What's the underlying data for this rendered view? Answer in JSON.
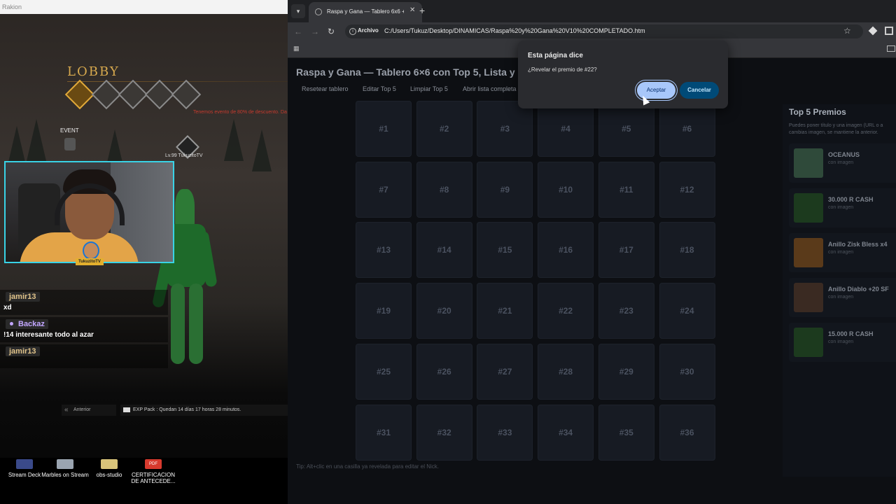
{
  "window": {
    "title": "Rakion"
  },
  "game": {
    "lobby_title": "LOBBY",
    "discount_text": "Tenemos evento de 80% de descuento. Da",
    "event_label": "EVENT",
    "player_label": "Lv.99 TukuzitoTV",
    "stream_logo_text": "TukuzitoTV",
    "prev_button": "Anterior",
    "exp_info": "EXP Pack : Quedan 14 días 17 horas 28 minutos."
  },
  "chat": [
    {
      "user": "jamir13",
      "message": "xd"
    },
    {
      "user": "Backaz",
      "message": "!14 interesante todo al azar"
    },
    {
      "user": "jamir13",
      "message": ""
    }
  ],
  "desktop_icons": [
    {
      "label": "Stream Deck",
      "color": "#3a4a8a"
    },
    {
      "label": "Marbles on Stream",
      "color": "#9aa4b0"
    },
    {
      "label": "obs-studio",
      "color": "#d9c47a"
    },
    {
      "label": "CERTIFICACION DE ANTECEDE...",
      "color": "#d83a2e",
      "badge": "PDF"
    }
  ],
  "browser": {
    "tab_title": "Raspa y Gana — Tablero 6x6 +",
    "address_scheme": "Archivo",
    "address_url": "C:/Users/Tukuz/Desktop/DINAMICAS/Raspa%20y%20Gana%20V10%20COMPLETADO.htm"
  },
  "page": {
    "title": "Raspa y Gana — Tablero 6×6 con Top 5, Lista y Nic",
    "menu": [
      "Resetear tablero",
      "Editar Top 5",
      "Limpiar Top 5",
      "Abrir lista completa"
    ],
    "cells": [
      "#1",
      "#2",
      "#3",
      "#4",
      "#5",
      "#6",
      "#7",
      "#8",
      "#9",
      "#10",
      "#11",
      "#12",
      "#13",
      "#14",
      "#15",
      "#16",
      "#17",
      "#18",
      "#19",
      "#20",
      "#21",
      "#22",
      "#23",
      "#24",
      "#25",
      "#26",
      "#27",
      "#28",
      "#29",
      "#30",
      "#31",
      "#32",
      "#33",
      "#34",
      "#35",
      "#36"
    ],
    "tip": "Tip: Alt+clic en una casilla ya revelada para editar el Nick."
  },
  "top5": {
    "title": "Top 5 Premios",
    "subtitle_1": "Puedes poner título y una imagen (URL o a",
    "subtitle_2": "cambias imagen, se mantiene la anterior.",
    "prizes": [
      {
        "name": "OCEANUS",
        "sub": "con imagen",
        "color": "#2f4a3a"
      },
      {
        "name": "30.000 R CASH",
        "sub": "con imagen",
        "color": "#1c3a1e"
      },
      {
        "name": "Anillo Zisk Bless x4",
        "sub": "con imagen",
        "color": "#5a3a1a"
      },
      {
        "name": "Anillo Diablo +20 SF",
        "sub": "con imagen",
        "color": "#3a2a22"
      },
      {
        "name": "15.000 R CASH",
        "sub": "con imagen",
        "color": "#1c3a1e"
      }
    ]
  },
  "dialog": {
    "title": "Esta página dice",
    "message": "¿Revelar el premio de #22?",
    "ok_label": "Aceptar",
    "cancel_label": "Cancelar"
  }
}
